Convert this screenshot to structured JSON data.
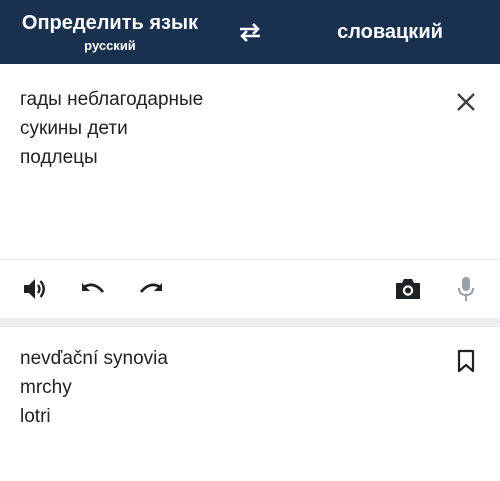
{
  "header": {
    "source_language": "Определить язык",
    "detected_language": "русский",
    "swap_icon": "swap-arrows-icon",
    "target_language": "словацкий",
    "background_color": "#19304f"
  },
  "input": {
    "lines": [
      "гады неблагодарные",
      "сукины дети",
      "подлецы"
    ],
    "clear_icon": "close-icon"
  },
  "toolbar": {
    "icons": [
      "speaker-icon",
      "undo-icon",
      "redo-icon",
      "camera-icon",
      "microphone-icon"
    ]
  },
  "output": {
    "lines": [
      "nevďační synovia",
      "mrchy",
      "lotri"
    ],
    "bookmark_icon": "bookmark-icon"
  }
}
